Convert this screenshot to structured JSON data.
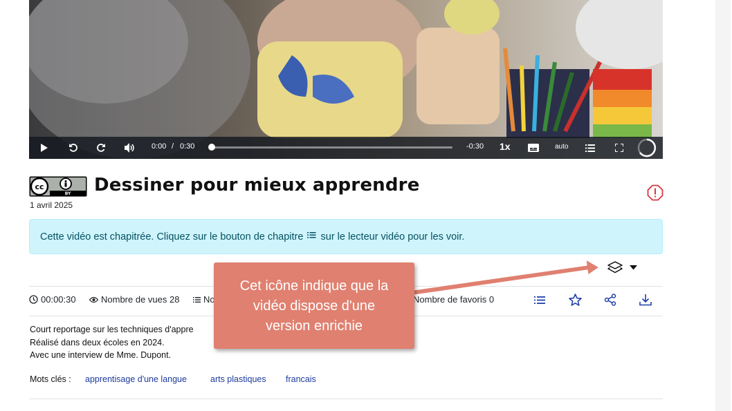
{
  "player": {
    "current_time": "0:00",
    "time_separator": "/",
    "duration": "0:30",
    "remaining": "-0:30",
    "playback_rate": "1x",
    "quality": "auto",
    "progress": 0
  },
  "video": {
    "title": "Dessiner pour mieux apprendre",
    "date": "1 avril 2025",
    "license_badge": "BY"
  },
  "alert": {
    "text_before": "Cette vidéo est chapitrée. Cliquez sur le bouton de chapitre",
    "text_after": "sur le lecteur vidéo pour les voir."
  },
  "meta": {
    "duration": "00:00:30",
    "views": "Nombre de vues 28",
    "playlists_partial": "No",
    "favorites_partial": "Nombre de favoris 0"
  },
  "description": {
    "line1": "Court reportage sur les techniques d'appre",
    "line2": "Réalisé dans deux écoles en 2024.",
    "line3": "Avec une interview de Mme. Dupont."
  },
  "tags": {
    "label": "Mots clés :",
    "items": [
      "apprentisage d'une langue",
      "arts plastiques",
      "francais"
    ]
  },
  "callout": {
    "line1": "Cet icône indique que la",
    "line2": "vidéo dispose d'une",
    "line3": "version enrichie",
    "color": "#e08070"
  },
  "icons": {
    "play": "play-icon",
    "rewind": "rewind-icon",
    "forward": "forward-icon",
    "volume": "volume-icon",
    "subtitles": "subtitles-icon",
    "chapters": "chapters-icon",
    "fullscreen": "fullscreen-icon",
    "loader": "loader-icon",
    "report": "report-icon",
    "enriched": "layers-icon"
  }
}
